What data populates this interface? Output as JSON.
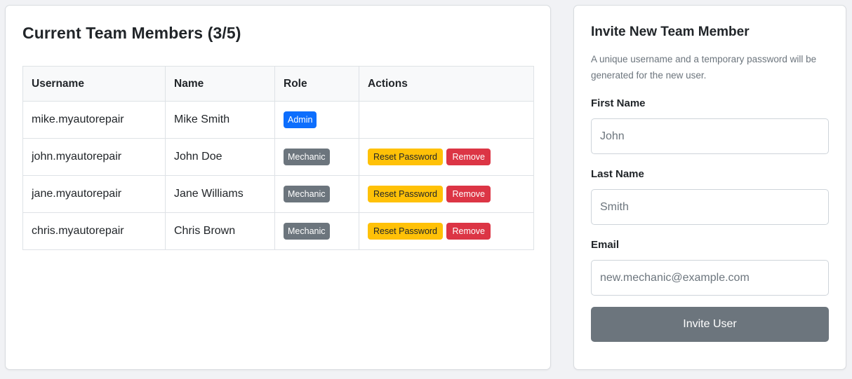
{
  "team": {
    "title": "Current Team Members (3/5)",
    "columns": [
      "Username",
      "Name",
      "Role",
      "Actions"
    ],
    "rows": [
      {
        "username": "mike.myautorepair",
        "name": "Mike Smith",
        "role": "Admin"
      },
      {
        "username": "john.myautorepair",
        "name": "John Doe",
        "role": "Mechanic",
        "reset_label": "Reset Password",
        "remove_label": "Remove"
      },
      {
        "username": "jane.myautorepair",
        "name": "Jane Williams",
        "role": "Mechanic",
        "reset_label": "Reset Password",
        "remove_label": "Remove"
      },
      {
        "username": "chris.myautorepair",
        "name": "Chris Brown",
        "role": "Mechanic",
        "reset_label": "Reset Password",
        "remove_label": "Remove"
      }
    ]
  },
  "invite": {
    "title": "Invite New Team Member",
    "description": "A unique username and a temporary password will be generated for the new user.",
    "first_name": {
      "label": "First Name",
      "value": "",
      "placeholder": "John"
    },
    "last_name": {
      "label": "Last Name",
      "value": "",
      "placeholder": "Smith"
    },
    "email": {
      "label": "Email",
      "value": "",
      "placeholder": "new.mechanic@example.com"
    },
    "submit_label": "Invite User"
  },
  "colors": {
    "primary": "#0d6efd",
    "secondary": "#6c757d",
    "warning": "#ffc107",
    "danger": "#dc3545"
  }
}
